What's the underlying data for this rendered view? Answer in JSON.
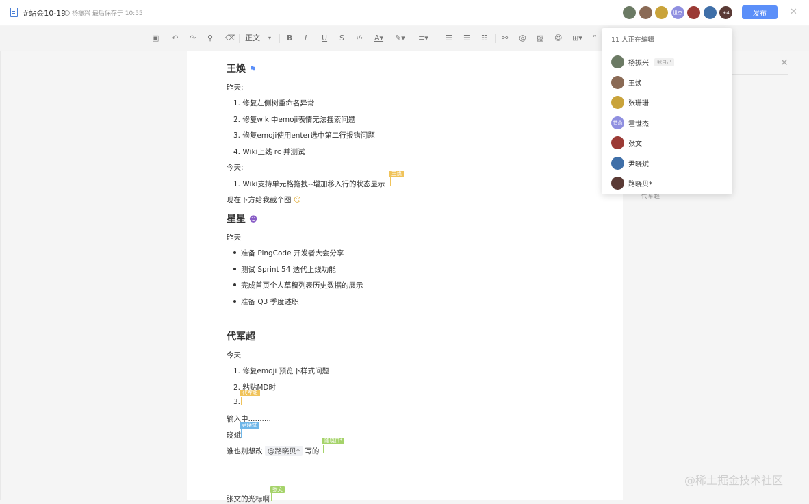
{
  "header": {
    "title": "#站会10-19",
    "save_status": "杨振兴 最后保存于 10:55",
    "publish_label": "发布",
    "close_icon": "close-icon",
    "avatars": [
      {
        "initial": "",
        "color": "#6b7a64"
      },
      {
        "initial": "",
        "color": "#8a6a55"
      },
      {
        "initial": "",
        "color": "#c9a33a"
      },
      {
        "initial": "世杰",
        "color": "#8f8fe0"
      },
      {
        "initial": "",
        "color": "#9b3a35"
      },
      {
        "initial": "",
        "color": "#3f6fa8"
      },
      {
        "initial": "+4",
        "color": "#5a3a35"
      }
    ]
  },
  "toolbar": {
    "paragraph_style": "正文"
  },
  "doc": {
    "s1_title": "王焕",
    "s1_yesterday": "昨天:",
    "s1_y1": "修复左侧树重命名异常",
    "s1_y2": "修复wiki中emoji表情无法搜索问题",
    "s1_y3": "修复emoji使用enter选中第二行报错问题",
    "s1_y4": "Wiki上线 rc 并测试",
    "s1_today": "今天:",
    "s1_t1": "Wiki支持单元格拖拽--增加移入行的状态显示",
    "s1_note": "现在下方给我截个图",
    "s2_title": "星星",
    "s2_yesterday": "昨天",
    "s2_b1": "准备 PingCode 开发者大会分享",
    "s2_b2": "测试 Sprint 54 迭代上线功能",
    "s2_b3": "完成首页个人草稿列表历史数据的展示",
    "s2_b4": "准备 Q3 季度述职",
    "s3_title": "代军超",
    "s3_today": "今天",
    "s3_t1": "修复emoji 预览下样式问题",
    "s3_t2": "粘贴MD时",
    "s3_typing": "输入中..........",
    "s3_xiaobin": "晓斌",
    "s3_line_pre": "谁也别想改",
    "s3_mention": "@路晓贝*",
    "s3_line_post": "写的",
    "s3_zhangwen": "张文的光标啊",
    "num1": "1.",
    "num2": "2.",
    "num3": "3.",
    "num4": "4."
  },
  "cursor_tags": {
    "wanghuan": "王焕",
    "daijunchao": "代军超",
    "yinxiaobin": "尹晓斌",
    "luxiaobei": "路晓贝*",
    "zhangwen": "张文"
  },
  "popup": {
    "header": "11 人正在编辑",
    "self_badge": "我自己",
    "editors": [
      {
        "name": "杨振兴",
        "color": "#6b7a64",
        "initial": ""
      },
      {
        "name": "王焕",
        "color": "#8a6a55",
        "initial": ""
      },
      {
        "name": "张珊珊",
        "color": "#c9a33a",
        "initial": ""
      },
      {
        "name": "霍世杰",
        "color": "#8f8fe0",
        "initial": "世杰"
      },
      {
        "name": "张文",
        "color": "#9b3a35",
        "initial": ""
      },
      {
        "name": "尹晓斌",
        "color": "#3f6fa8",
        "initial": ""
      },
      {
        "name": "路晓贝*",
        "color": "#5a3a35",
        "initial": ""
      }
    ]
  },
  "side_panel": {
    "text": "代军超"
  },
  "watermark": "@稀土掘金技术社区",
  "colors": {
    "accent": "#5b8ff9",
    "tag_wanghuan": "#f0c35a",
    "tag_daijunchao": "#f0c35a",
    "tag_yinxiaobin": "#6fb6e8",
    "tag_luxiaobei": "#a5d36a",
    "tag_zhangwen": "#a5d36a"
  }
}
